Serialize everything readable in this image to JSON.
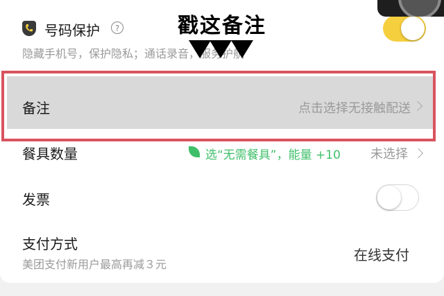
{
  "overlay": {
    "title": "戳这备注"
  },
  "phone_protect": {
    "title": "号码保护",
    "help": "?",
    "subtitle": "隐藏手机号，保护隐私；通话录音，服务护航",
    "enabled": true
  },
  "remark": {
    "label": "备注",
    "value": "点击选择无接触配送"
  },
  "tableware": {
    "label": "餐具数量",
    "hint": "选“无需餐具”，能量 +10",
    "value": "未选择"
  },
  "invoice": {
    "label": "发票",
    "enabled": false
  },
  "payment": {
    "label": "支付方式",
    "subtitle": "美团支付新用户最高再减３元",
    "value": "在线支付"
  },
  "colors": {
    "toggle_on": "#f6cf3f",
    "highlight_border": "#d9535f",
    "green_hint": "#3fbf6a"
  }
}
